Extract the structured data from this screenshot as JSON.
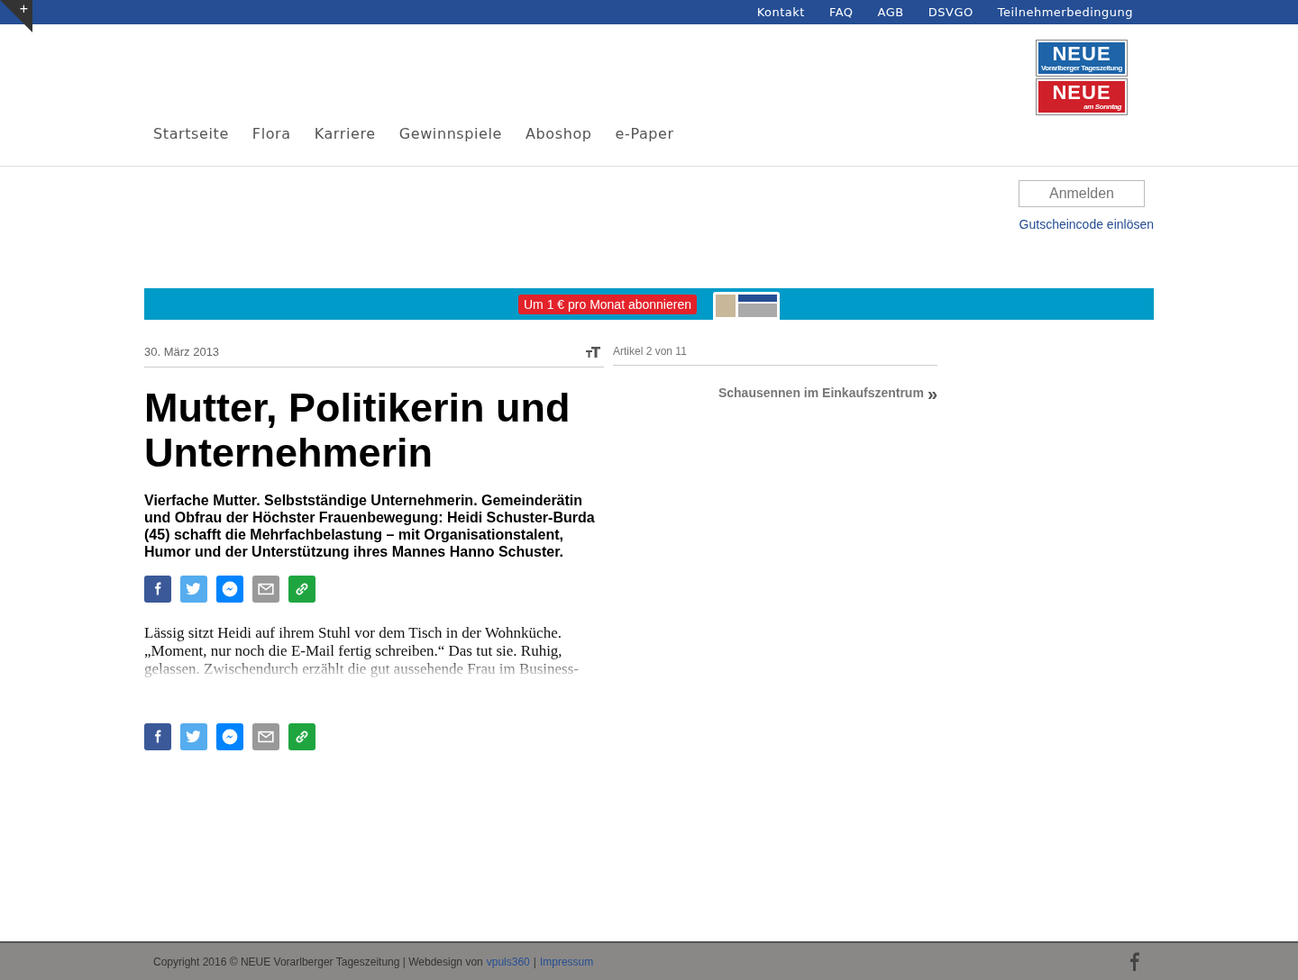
{
  "top_links": [
    "Kontakt",
    "FAQ",
    "AGB",
    "DSVGO",
    "Teilnehmerbedingung"
  ],
  "corner_toggle": "+",
  "logos": [
    {
      "kind": "daily",
      "title": "NEUE",
      "subtitle": "Vorarlberger Tageszeitung"
    },
    {
      "kind": "sunday",
      "title": "NEUE",
      "subtitle": "am Sonntag"
    }
  ],
  "nav": [
    "Startseite",
    "Flora",
    "Karriere",
    "Gewinnspiele",
    "Aboshop",
    "e-Paper"
  ],
  "login": {
    "button": "Anmelden",
    "voucher_link": "Gutscheincode einlösen"
  },
  "banner": {
    "cta": "Um 1 € pro Monat abonnieren"
  },
  "article": {
    "date": "30. März 2013",
    "position": "Artikel 2 von 11",
    "next_link": "Schausennen im Einkaufszentrum",
    "next_arrow": "»",
    "title": "Mutter, Politikerin und Unternehmerin",
    "lead": "Vierfache Mutter. Selbstständige Unternehmerin. Gemeinderätin und Obfrau der Höchster Frauenbewegung: Heidi Schuster-Burda (45) schafft die Mehrfachbelastung – mit Organisationstalent, Humor und der Unterstützung ihres Mannes Hanno Schuster.",
    "body": "Lässig sitzt Heidi auf ihrem Stuhl vor dem Tisch in der Wohnküche. „Moment, nur noch die E-Mail fertig schreiben.“ Das tut sie. Ruhig, gelassen. Zwischendurch erzählt die gut aussehende Frau im Business-"
  },
  "share_buttons": [
    {
      "kind": "facebook",
      "color": "#3b5998"
    },
    {
      "kind": "twitter",
      "color": "#55acee"
    },
    {
      "kind": "messenger",
      "color": "#0084ff"
    },
    {
      "kind": "email",
      "color": "#999999"
    },
    {
      "kind": "link",
      "color": "#1fa540"
    }
  ],
  "footer": {
    "copyright": "Copyright 2016 © NEUE Vorarlberger Tageszeitung | Webdesign von",
    "links": [
      "vpuls360",
      "Impressum"
    ],
    "separator": "|"
  }
}
